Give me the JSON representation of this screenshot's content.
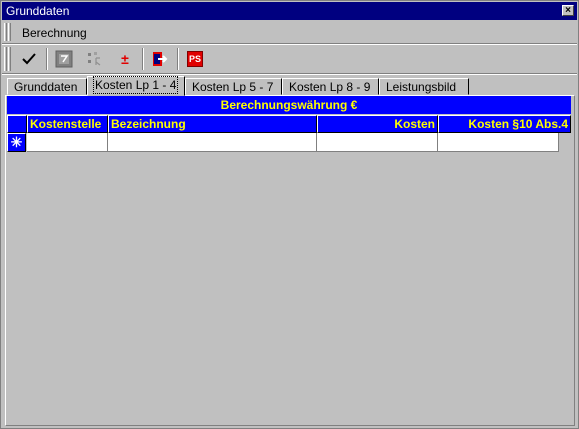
{
  "window": {
    "title": "Grunddaten",
    "close_glyph": "×"
  },
  "menu": {
    "items": [
      {
        "label": "Berechnung"
      }
    ]
  },
  "toolbar": {
    "buttons": [
      {
        "name": "confirm",
        "icon": "checkmark-icon",
        "glyph": "✓"
      },
      {
        "name": "calc-sheet",
        "icon": "sheet-icon",
        "glyph": ""
      },
      {
        "name": "column-settings",
        "icon": "column-icon",
        "glyph": ""
      },
      {
        "name": "plus-minus",
        "icon": "plus-minus-icon",
        "glyph": "±"
      },
      {
        "name": "exit",
        "icon": "exit-arrow-icon",
        "glyph": ""
      },
      {
        "name": "report",
        "icon": "report-icon",
        "glyph": "PS"
      }
    ]
  },
  "tabs": [
    {
      "label": "Grunddaten",
      "active": false
    },
    {
      "label": "Kosten Lp 1 - 4",
      "active": true
    },
    {
      "label": "Kosten Lp 5 - 7",
      "active": false
    },
    {
      "label": "Kosten Lp 8 - 9",
      "active": false
    },
    {
      "label": "Leistungsbild",
      "active": false
    }
  ],
  "grid": {
    "title": "Berechnungswährung €",
    "columns": [
      "Kostenstelle",
      "Bezeichnung",
      "Kosten",
      "Kosten §10 Abs.4"
    ],
    "new_row_marker": "✳",
    "rows": [
      [
        "",
        "",
        "",
        ""
      ]
    ]
  },
  "colors": {
    "titlebar": "#000080",
    "grid_header_bg": "#0000ff",
    "grid_header_text": "#ffff00",
    "face": "#c0c0c0"
  }
}
